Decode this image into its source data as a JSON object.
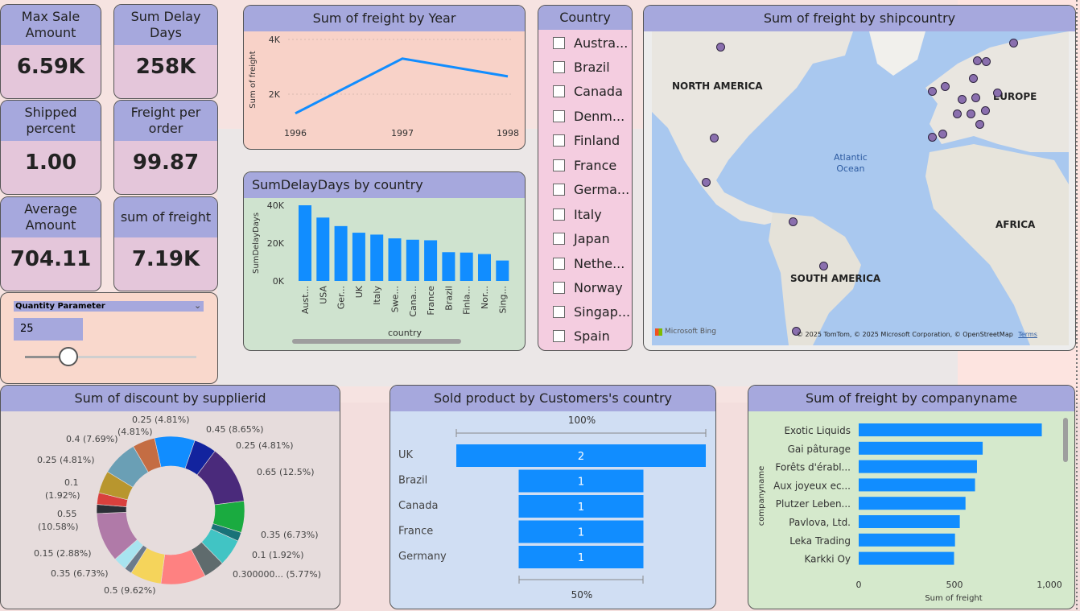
{
  "kpis": [
    {
      "title": "Max Sale Amount",
      "value": "6.59K"
    },
    {
      "title": "Sum Delay Days",
      "value": "258K"
    },
    {
      "title": "Shipped percent",
      "value": "1.00"
    },
    {
      "title": "Freight per order",
      "value": "99.87"
    },
    {
      "title": "Average Amount",
      "value": "704.11"
    },
    {
      "title": "sum of freight",
      "value": "7.19K"
    }
  ],
  "quantity_parameter": {
    "title": "Quantity Parameter",
    "value": "25",
    "slider_fraction": 0.25
  },
  "freight_by_year": {
    "title": "Sum of freight by Year",
    "ylabel": "Sum of freight",
    "y_ticks": [
      "4K",
      "2K"
    ],
    "chart_data": {
      "type": "line",
      "x": [
        "1996",
        "1997",
        "1998"
      ],
      "values": [
        1300,
        3300,
        2650
      ],
      "ylim": [
        0,
        4000
      ]
    }
  },
  "delay_by_country": {
    "title": "SumDelayDays by country",
    "ylabel": "SumDelayDays",
    "xlabel": "country",
    "y_ticks": [
      "40K",
      "20K",
      "0K"
    ],
    "chart_data": {
      "type": "bar",
      "categories": [
        "Aust...",
        "USA",
        "Ger...",
        "UK",
        "Italy",
        "Swe...",
        "Cana...",
        "France",
        "Brazil",
        "Finla...",
        "Nor...",
        "Sing..."
      ],
      "values": [
        40000,
        33500,
        29000,
        25500,
        24500,
        22500,
        21800,
        21500,
        15200,
        15000,
        14200,
        10800
      ],
      "ylim": [
        0,
        45000
      ]
    }
  },
  "country_slicer": {
    "title": "Country",
    "items": [
      "Austra...",
      "Brazil",
      "Canada",
      "Denm...",
      "Finland",
      "France",
      "Germa...",
      "Italy",
      "Japan",
      "Nethe...",
      "Norway",
      "Singap...",
      "Spain"
    ]
  },
  "map": {
    "title": "Sum of freight by shipcountry",
    "labels": {
      "na": "NORTH AMERICA",
      "sa": "SOUTH AMERICA",
      "europe": "EUROPE",
      "africa": "AFRICA",
      "ocean1": "Atlantic",
      "ocean2": "Ocean"
    },
    "attribution": "© 2025 TomTom, © 2025 Microsoft Corporation, © OpenStreetMap",
    "terms": "Terms",
    "bing": "Microsoft Bing"
  },
  "discount_donut": {
    "title": "Sum of discount by supplierid",
    "chart_data": {
      "type": "pie",
      "slices": [
        {
          "label": "0.45 (8.65%)",
          "value": 8.65,
          "color": "#118dff"
        },
        {
          "label": "0.25 (4.81%)",
          "value": 4.81,
          "color": "#12239e"
        },
        {
          "label": "0.65 (12.5%)",
          "value": 12.5,
          "color": "#4a2a7b"
        },
        {
          "label": "0.35 (6.73%)",
          "value": 6.73,
          "color": "#1aab40"
        },
        {
          "label": "0.1 (1.92%)",
          "value": 1.92,
          "color": "#197278"
        },
        {
          "label": "0.300000... (5.77%)",
          "value": 5.77,
          "color": "#41c4c4"
        },
        {
          "label": "",
          "value": 4.5,
          "color": "#5f6b6d"
        },
        {
          "label": "0.5 (9.62%)",
          "value": 9.62,
          "color": "#fe8181"
        },
        {
          "label": "0.35 (6.73%)",
          "value": 6.73,
          "color": "#f5d45b"
        },
        {
          "label": "",
          "value": 1.6,
          "color": "#6b7b8b"
        },
        {
          "label": "0.15 (2.88%)",
          "value": 2.88,
          "color": "#a8e4f0"
        },
        {
          "label": "0.55 (10.58%)",
          "value": 10.58,
          "color": "#b07aa8"
        },
        {
          "label": "0.1 (1.92%)",
          "value": 1.92,
          "color": "#2b2f36"
        },
        {
          "label": "",
          "value": 2.5,
          "color": "#d9403d"
        },
        {
          "label": "0.25 (4.81%)",
          "value": 4.81,
          "color": "#b8962e"
        },
        {
          "label": "0.4 (7.69%)",
          "value": 7.69,
          "color": "#6a9fb5"
        },
        {
          "label": "0.25 (4.81%)",
          "value": 4.81,
          "color": "#c46d43"
        }
      ]
    }
  },
  "funnel": {
    "title": "Sold product by Customers's country",
    "top_label": "100%",
    "bottom_label": "50%",
    "chart_data": {
      "type": "bar",
      "categories": [
        "UK",
        "Brazil",
        "Canada",
        "France",
        "Germany"
      ],
      "values": [
        2,
        1,
        1,
        1,
        1
      ]
    }
  },
  "freight_by_company": {
    "title": "Sum of freight by companyname",
    "ylabel": "companyname",
    "xlabel": "Sum of freight",
    "x_ticks": [
      "0",
      "500",
      "1,000"
    ],
    "chart_data": {
      "type": "bar",
      "categories": [
        "Exotic Liquids",
        "Gai pâturage",
        "Forêts d'érabl...",
        "Aux joyeux ec...",
        "Plutzer Leben...",
        "Pavlova, Ltd.",
        "Leka Trading",
        "Karkki Oy"
      ],
      "values": [
        960,
        650,
        620,
        610,
        560,
        530,
        505,
        500
      ],
      "xlim": [
        0,
        1100
      ]
    }
  },
  "colors": {
    "bar": "#118dff",
    "header": "#a6a8dd"
  }
}
